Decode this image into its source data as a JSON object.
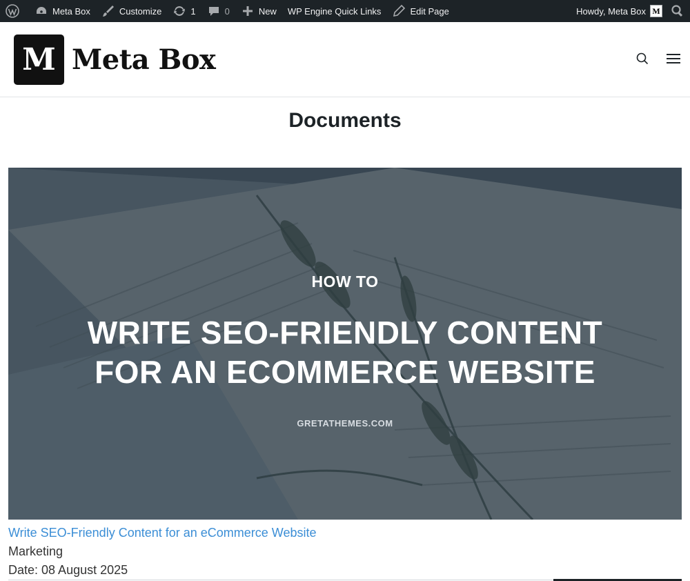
{
  "adminbar": {
    "site_name": "Meta Box",
    "customize": "Customize",
    "updates_count": "1",
    "comments_count": "0",
    "new_label": "New",
    "quick_links": "WP Engine Quick Links",
    "edit_page": "Edit Page",
    "howdy": "Howdy, Meta Box",
    "avatar_letter": "M"
  },
  "header": {
    "logo_letter": "M",
    "logo_text": "Meta Box"
  },
  "page": {
    "title": "Documents"
  },
  "post": {
    "image_text": {
      "how_to": "HOW TO",
      "line1": "WRITE SEO-FRIENDLY CONTENT",
      "line2": "FOR AN ECOMMERCE WEBSITE",
      "domain": "GRETATHEMES.COM"
    },
    "title": "Write SEO-Friendly Content for an eCommerce Website",
    "category": "Marketing",
    "date_label": "Date: ",
    "date_value": "08 August 2025"
  },
  "colors": {
    "adminbar_bg": "#1d2327",
    "link": "#3b8ed6",
    "text": "#333333"
  },
  "icons": [
    "wordpress-icon",
    "dashboard-icon",
    "brush-icon",
    "updates-icon",
    "comments-icon",
    "plus-icon",
    "pencil-icon",
    "search-icon",
    "menu-icon"
  ]
}
